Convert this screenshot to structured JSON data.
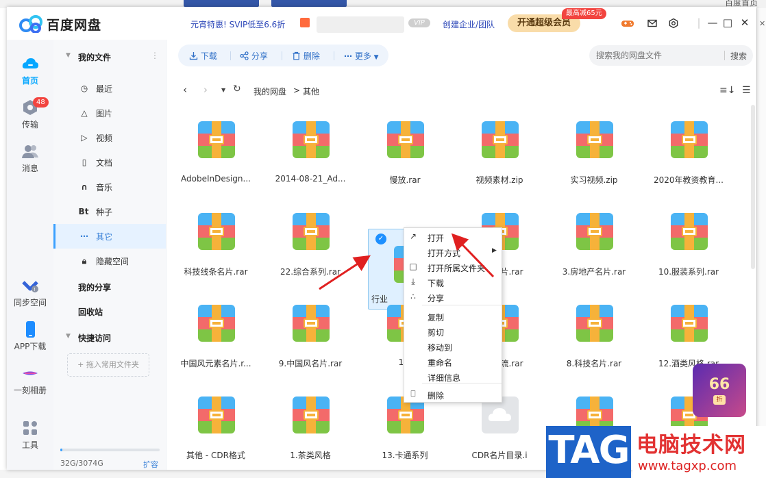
{
  "background": {
    "top_right_text": "百度首页"
  },
  "app": {
    "title": "百度网盘",
    "promo_text": "元宵特惠! SVIP低至6.6折",
    "vip_badge": "VIP",
    "enterprise_link": "创建企业/团队",
    "super_member_button": "开通超级会员",
    "discount_badge": "最高减65元"
  },
  "leftnav": {
    "items": [
      {
        "label": "首页",
        "icon": "cloud-home-icon"
      },
      {
        "label": "传输",
        "icon": "transfer-icon",
        "badge": "48"
      },
      {
        "label": "消息",
        "icon": "message-icon"
      },
      {
        "label": "同步空间",
        "icon": "sync-icon"
      },
      {
        "label": "APP下载",
        "icon": "phone-icon"
      },
      {
        "label": "一刻相册",
        "icon": "album-icon"
      },
      {
        "label": "工具",
        "icon": "tools-icon"
      }
    ]
  },
  "sidebar": {
    "my_files": "我的文件",
    "items": [
      {
        "label": "最近",
        "icon": "clock-icon"
      },
      {
        "label": "图片",
        "icon": "image-icon"
      },
      {
        "label": "视频",
        "icon": "video-icon"
      },
      {
        "label": "文档",
        "icon": "document-icon"
      },
      {
        "label": "音乐",
        "icon": "music-icon"
      },
      {
        "label": "种子",
        "icon": "bt-icon",
        "glyph": "Bt"
      },
      {
        "label": "其它",
        "icon": "more-icon"
      },
      {
        "label": "隐藏空间",
        "icon": "lock-icon"
      }
    ],
    "my_share": "我的分享",
    "recycle_bin": "回收站",
    "quick_access": "快捷访问",
    "dropzone": "+ 拖入常用文件夹",
    "quota": "32G/3074G",
    "quota_fraction": 0.0104,
    "expand": "扩容"
  },
  "toolbar": {
    "download": "下载",
    "share": "分享",
    "delete": "删除",
    "more": "更多"
  },
  "search": {
    "placeholder": "搜索我的网盘文件",
    "button": "搜索"
  },
  "breadcrumb": {
    "root": "我的网盘",
    "sep": ">",
    "current": "其他"
  },
  "files": [
    {
      "name": "AdobeInDesign...",
      "type": "rar"
    },
    {
      "name": "2014-08-21_Ad...",
      "type": "rar"
    },
    {
      "name": "慢放.rar",
      "type": "rar"
    },
    {
      "name": "视频素材.zip",
      "type": "rar"
    },
    {
      "name": "实习视频.zip",
      "type": "rar"
    },
    {
      "name": "2020年教资教育...",
      "type": "rar"
    },
    {
      "name": "科技线条名片.rar",
      "type": "rar"
    },
    {
      "name": "22.综合系列.rar",
      "type": "rar"
    },
    {
      "name": "行业",
      "type": "rar",
      "selected": true
    },
    {
      "name": "背景名片.rar",
      "type": "rar"
    },
    {
      "name": "3.房地产名片.rar",
      "type": "rar"
    },
    {
      "name": "10.服装系列.rar",
      "type": "rar"
    },
    {
      "name": "中国风元素名片.r...",
      "type": "rar"
    },
    {
      "name": "9.中国风名片.rar",
      "type": "rar"
    },
    {
      "name": "18.",
      "type": "rar"
    },
    {
      "name": "快递物流.rar",
      "type": "rar"
    },
    {
      "name": "8.科技名片.rar",
      "type": "rar"
    },
    {
      "name": "12.酒类风格.rar",
      "type": "rar"
    },
    {
      "name": "其他 - CDR格式",
      "type": "rar"
    },
    {
      "name": "1.茶类风格",
      "type": "rar"
    },
    {
      "name": "13.卡通系列",
      "type": "rar"
    },
    {
      "name": "CDR名片目录.i",
      "type": "cloud"
    },
    {
      "name": "",
      "type": "rar"
    },
    {
      "name": "",
      "type": "rar"
    }
  ],
  "context_menu": [
    {
      "label": "打开",
      "icon": "open-arrow-icon"
    },
    {
      "label": "打开方式",
      "icon": "",
      "submenu": true
    },
    {
      "label": "打开所属文件夹",
      "icon": "folder-icon"
    },
    {
      "label": "下载",
      "icon": "download-icon"
    },
    {
      "label": "分享",
      "icon": "share-icon"
    },
    {
      "label": "复制",
      "icon": ""
    },
    {
      "label": "剪切",
      "icon": ""
    },
    {
      "label": "移动到",
      "icon": ""
    },
    {
      "label": "重命名",
      "icon": ""
    },
    {
      "label": "详细信息",
      "icon": ""
    },
    {
      "label": "删除",
      "icon": "trash-icon"
    }
  ],
  "sticker": {
    "number": "66",
    "suffix": "折"
  },
  "watermark": {
    "tag": "TAG",
    "title": "电脑技术网",
    "url": "www.tagxp.com"
  },
  "colors": {
    "accent": "#06a7ff",
    "link": "#2b46b8",
    "archive_red": "#f36a6a",
    "archive_green": "#7ec545",
    "archive_blue": "#4ab3f4",
    "archive_orange": "#f6b23a"
  }
}
